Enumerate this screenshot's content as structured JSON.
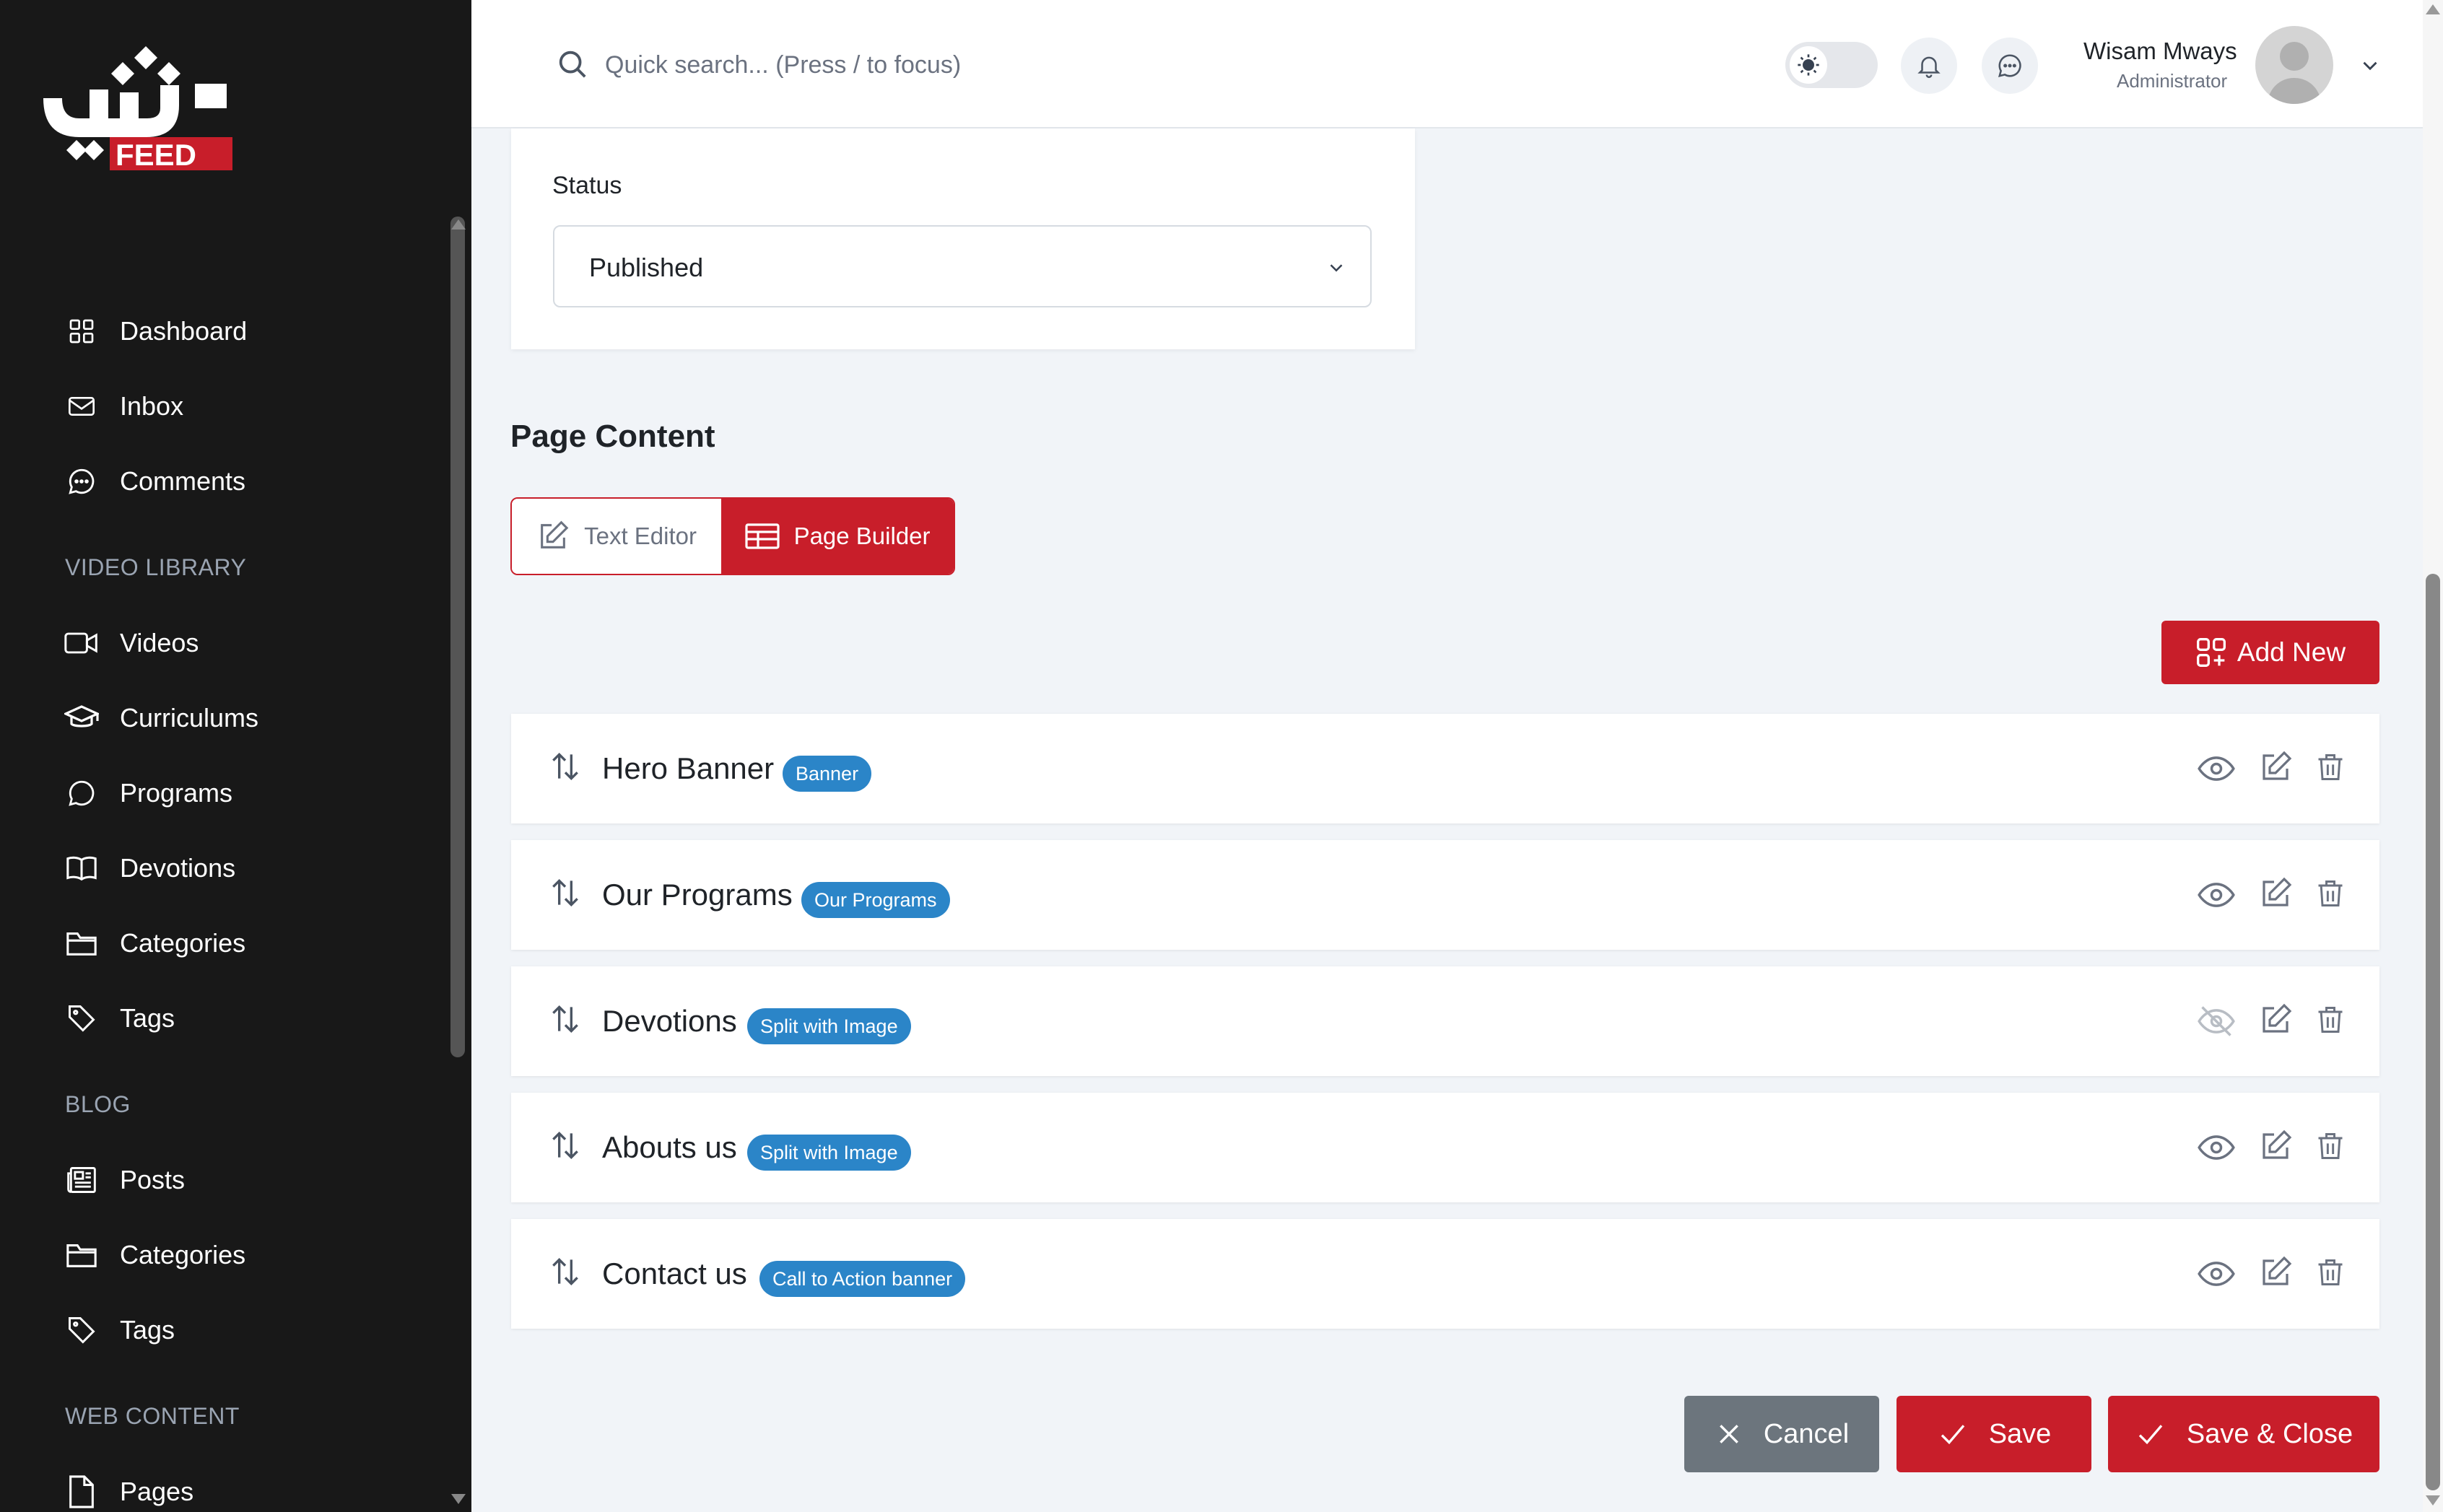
{
  "brand": {
    "logo_text": "FEED",
    "accent": "#c81e2a",
    "sidebar_bg": "#181818",
    "badge_color": "#2b85c8"
  },
  "header": {
    "search": {
      "placeholder": "Quick search... (Press / to focus)",
      "icon": "search-icon"
    },
    "user": {
      "name": "Wisam Mways",
      "role": "Administrator"
    }
  },
  "sidebar": {
    "main": [
      {
        "label": "Dashboard",
        "icon": "grid-icon"
      },
      {
        "label": "Inbox",
        "icon": "mail-icon"
      },
      {
        "label": "Comments",
        "icon": "chat-icon"
      }
    ],
    "sections": [
      {
        "title": "VIDEO LIBRARY",
        "items": [
          {
            "label": "Videos",
            "icon": "video-icon"
          },
          {
            "label": "Curriculums",
            "icon": "graduation-cap-icon"
          },
          {
            "label": "Programs",
            "icon": "message-circle-icon"
          },
          {
            "label": "Devotions",
            "icon": "book-icon"
          },
          {
            "label": "Categories",
            "icon": "folder-icon"
          },
          {
            "label": "Tags",
            "icon": "tag-icon"
          }
        ]
      },
      {
        "title": "BLOG",
        "items": [
          {
            "label": "Posts",
            "icon": "newspaper-icon"
          },
          {
            "label": "Categories",
            "icon": "folder-icon"
          },
          {
            "label": "Tags",
            "icon": "tag-icon"
          }
        ]
      },
      {
        "title": "WEB CONTENT",
        "items": [
          {
            "label": "Pages",
            "icon": "file-icon"
          }
        ]
      }
    ]
  },
  "status": {
    "label": "Status",
    "value": "Published"
  },
  "page_content": {
    "title": "Page Content",
    "editor_modes": {
      "text_editor": "Text Editor",
      "page_builder": "Page Builder",
      "active": "Page Builder"
    },
    "add_new": "Add New",
    "blocks": [
      {
        "name": "Hero Banner",
        "type": "Banner",
        "visible": true
      },
      {
        "name": "Our Programs",
        "type": "Our Programs",
        "visible": true
      },
      {
        "name": "Devotions",
        "type": "Split with Image",
        "visible": false
      },
      {
        "name": "Abouts us",
        "type": "Split with Image",
        "visible": true
      },
      {
        "name": "Contact us",
        "type": "Call to Action banner",
        "visible": true
      }
    ]
  },
  "actions": {
    "cancel": "Cancel",
    "save": "Save",
    "save_close": "Save & Close"
  }
}
